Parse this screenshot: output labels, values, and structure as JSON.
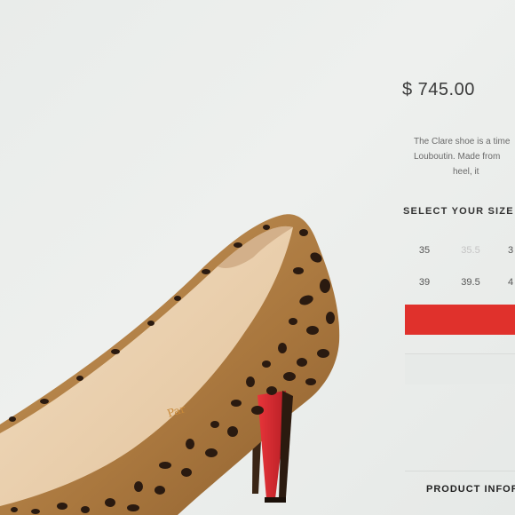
{
  "product": {
    "price": "$ 745.00",
    "description_lines": [
      "The Clare shoe is a time",
      "Louboutin. Made from",
      "heel, it"
    ],
    "insole_stamp": "Par"
  },
  "size_selector": {
    "heading": "SELECT YOUR SIZE",
    "sizes": [
      {
        "label": "35",
        "available": true
      },
      {
        "label": "35.5",
        "available": false
      },
      {
        "label": "3",
        "available": true
      },
      {
        "label": "39",
        "available": true
      },
      {
        "label": "39.5",
        "available": true
      },
      {
        "label": "4",
        "available": true
      }
    ]
  },
  "actions": {
    "add_label": "",
    "secondary_label": ""
  },
  "info": {
    "heading": "PRODUCT INFORM"
  },
  "colors": {
    "accent_red": "#e0312c",
    "sole_red": "#d42a2e",
    "leopard_base": "#b8864a",
    "leopard_spot": "#2a1a10"
  }
}
